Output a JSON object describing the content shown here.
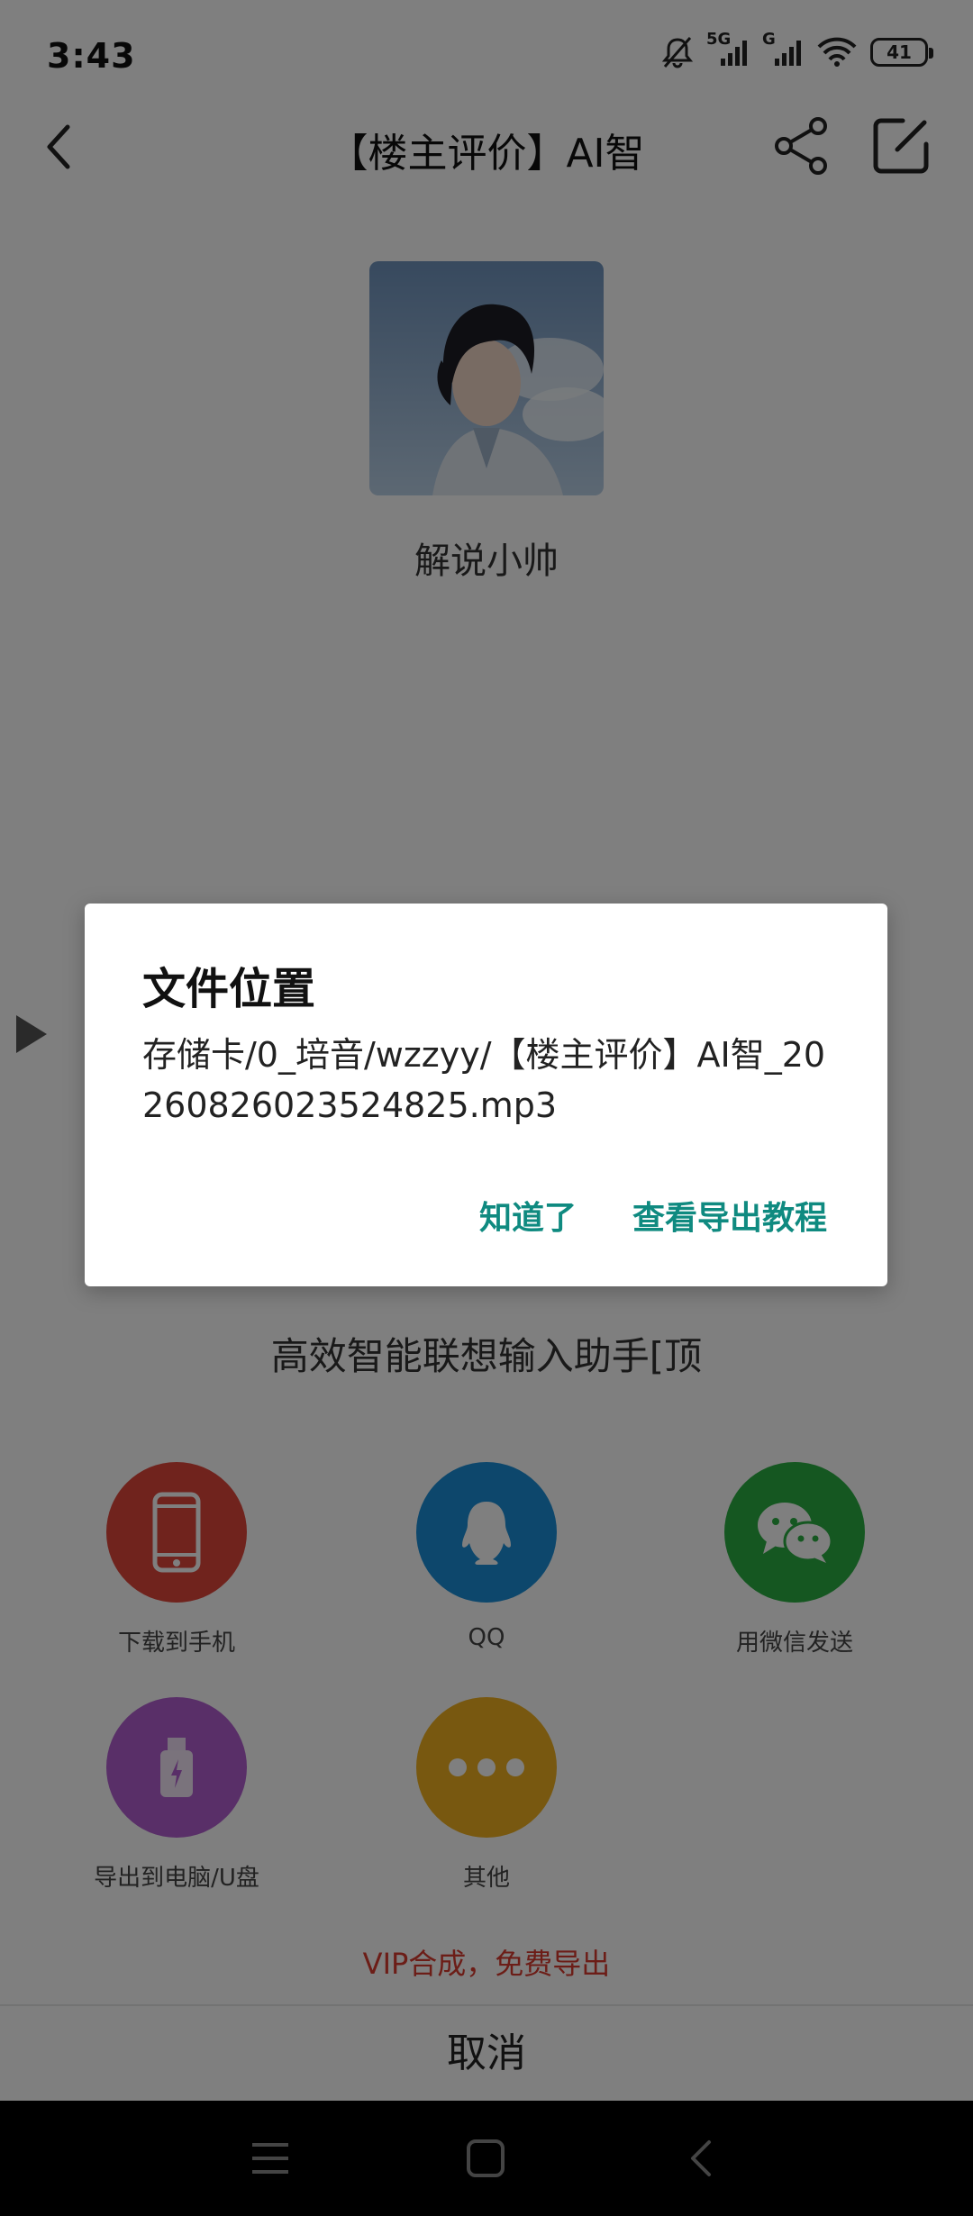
{
  "status_bar": {
    "time": "3:43",
    "network_label_1": "5G",
    "network_label_2": "G",
    "battery": "41"
  },
  "header": {
    "title": "【楼主评价】AI智"
  },
  "main": {
    "avatar_name": "解说小帅",
    "subtitle_text": "高效智能联想输入助手[顶"
  },
  "share_sheet": {
    "items": [
      {
        "label": "下载到手机",
        "icon": "phone-icon",
        "color": "#e0463b"
      },
      {
        "label": "QQ",
        "icon": "qq-penguin-icon",
        "color": "#1a8fd8"
      },
      {
        "label": "用微信发送",
        "icon": "wechat-icon",
        "color": "#2aae42"
      },
      {
        "label": "导出到电脑/U盘",
        "icon": "usb-drive-icon",
        "color": "#b25fd0"
      },
      {
        "label": "其他",
        "icon": "more-dots-icon",
        "color": "#f0b020"
      }
    ],
    "vip_text": "VIP合成，免费导出",
    "cancel_label": "取消"
  },
  "dialog": {
    "title": "文件位置",
    "body": "存储卡/0_培音/wzzyy/【楼主评价】AI智_20260826023524825.mp3",
    "ok_label": "知道了",
    "tutorial_label": "查看导出教程",
    "accent_color": "#0f8a80"
  }
}
